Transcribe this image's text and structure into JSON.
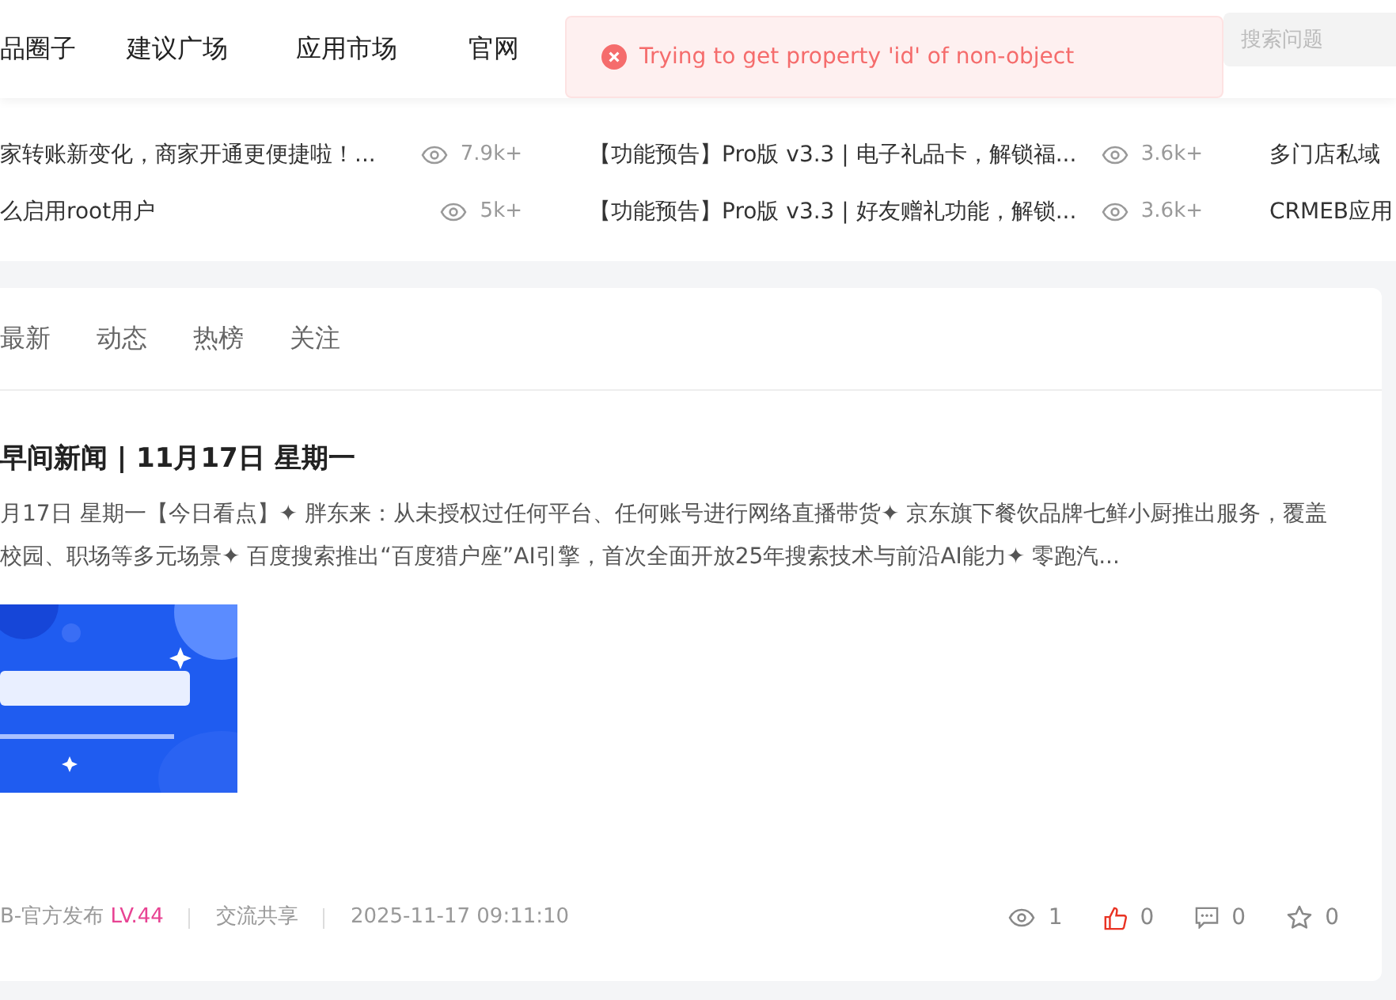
{
  "nav": {
    "items": [
      {
        "label": "品圈子"
      },
      {
        "label": "建议广场"
      },
      {
        "label": "应用市场"
      },
      {
        "label": "官网"
      }
    ],
    "search": {
      "placeholder": "搜索问题"
    }
  },
  "toast": {
    "kind": "error",
    "message": "Trying to get property 'id' of non-object"
  },
  "hot_lists": [
    {
      "rows": [
        {
          "title": "家转账新变化，商家开通更便捷啦！...",
          "views": "7.9k+"
        },
        {
          "title": "么启用root用户",
          "views": "5k+"
        }
      ]
    },
    {
      "rows": [
        {
          "title": "【功能预告】Pro版 v3.3 | 电子礼品卡，解锁福...",
          "views": "3.6k+"
        },
        {
          "title": "【功能预告】Pro版 v3.3 | 好友赠礼功能，解锁...",
          "views": "3.6k+"
        }
      ]
    },
    {
      "rows": [
        {
          "title": "多门店私域"
        },
        {
          "title": "CRMEB应用"
        }
      ]
    }
  ],
  "feed": {
    "tabs": [
      {
        "label": "最新",
        "selected": false
      },
      {
        "label": "动态",
        "selected": false
      },
      {
        "label": "热榜",
        "selected": false
      },
      {
        "label": "关注",
        "selected": false
      }
    ],
    "post": {
      "title": "早间新闻 | 11月17日 星期一",
      "summary": "月17日 星期一【今日看点】✦ 胖东来：从未授权过任何平台、任何账号进行网络直播带货✦ 京东旗下餐饮品牌七鲜小厨推出服务，覆盖校园、职场等多元场景✦ 百度搜索推出“百度猎户座”AI引擎，首次全面开放25年搜索技术与前沿AI能力✦ 零跑汽...",
      "author": "B-官方发布",
      "level": "LV.44",
      "category": "交流共享",
      "time": "2025-11-17 09:11:10",
      "stats": [
        {
          "kind": "views",
          "count": "1",
          "active": false
        },
        {
          "kind": "likes",
          "count": "0",
          "active": true
        },
        {
          "kind": "comments",
          "count": "0",
          "active": false
        },
        {
          "kind": "favorites",
          "count": "0",
          "active": false
        }
      ]
    }
  }
}
